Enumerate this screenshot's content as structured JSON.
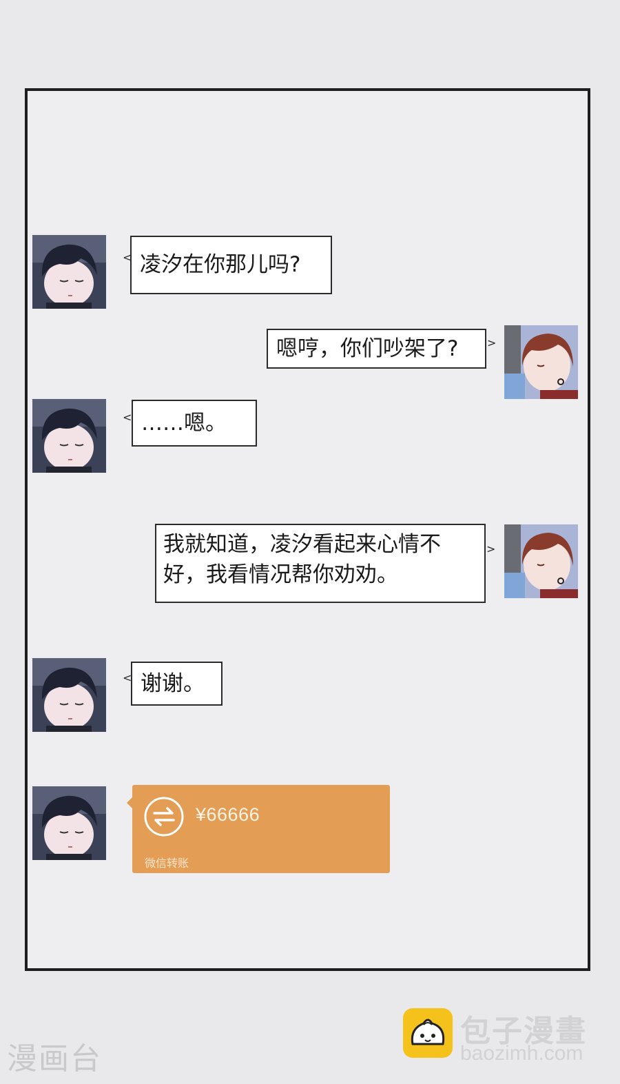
{
  "messages": [
    {
      "sender": "him",
      "text": "凌汐在你那儿吗?"
    },
    {
      "sender": "her",
      "text": "嗯哼，你们吵架了?"
    },
    {
      "sender": "him",
      "text": "……嗯。"
    },
    {
      "sender": "her",
      "line1": "我就知道，凌汐看起来心情不",
      "line2": "好，我看情况帮你劝劝。"
    },
    {
      "sender": "him",
      "text": "谢谢。"
    }
  ],
  "transfer": {
    "amount": "¥66666",
    "label": "微信转账",
    "icon": "transfer-arrows-icon",
    "color": "#e39d55"
  },
  "watermarks": {
    "left": "漫画台",
    "brand": "包子漫畫",
    "url": "baozimh.com"
  },
  "colors": {
    "frame": "#1e1e1e",
    "background": "#eeeef0",
    "bubble_border": "#2a2a2a"
  }
}
